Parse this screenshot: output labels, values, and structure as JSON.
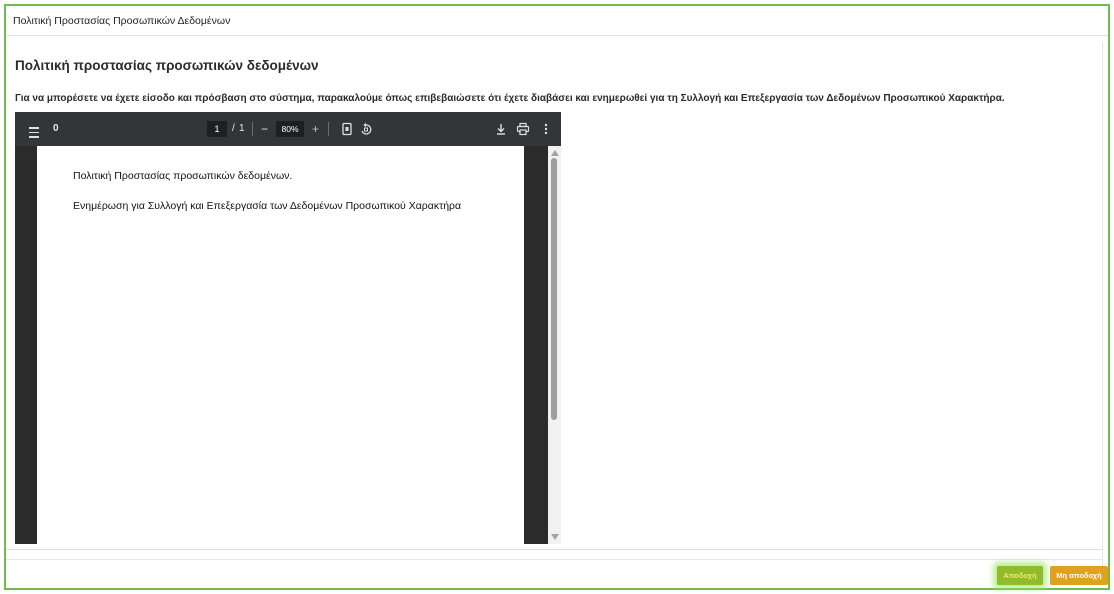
{
  "dialog": {
    "title": "Πολιτική Προστασίας Προσωπικών Δεδομένων",
    "heading": "Πολιτική προστασίας προσωπικών δεδομένων",
    "instruction": "Για να μπορέσετε να έχετε είσοδο και πρόσβαση στο σύστημα, παρακαλούμε όπως επιβεβαιώσετε ότι έχετε διαβάσει και ενημερωθεί για τη Συλλογή και Επεξεργασία των Δεδομένων Προσωπικού Χαρακτήρα."
  },
  "pdf_viewer": {
    "sidebar_count": "0",
    "page_current": "1",
    "page_separator": "/",
    "page_total": "1",
    "zoom_out": "−",
    "zoom_value": "80%",
    "zoom_in": "+",
    "page_text_1": "Πολιτική Προστασίας προσωπικών δεδομένων.",
    "page_text_2": "Ενημέρωση για Συλλογή και Επεξεργασία των Δεδομένων Προσωπικού Χαρακτήρα"
  },
  "footer": {
    "accept_label": "Αποδοχή",
    "decline_label": "Μη αποδοχή"
  },
  "colors": {
    "frame_border": "#6cc04a",
    "accept_button": "#8fbb2c",
    "decline_button": "#e0a21c",
    "pdf_toolbar": "#323639"
  },
  "icons": [
    "menu-icon",
    "fit-page-icon",
    "rotate-icon",
    "download-icon",
    "print-icon",
    "more-options-icon"
  ]
}
